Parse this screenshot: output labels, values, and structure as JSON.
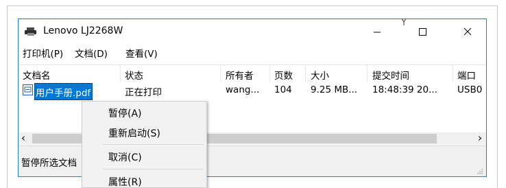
{
  "window": {
    "title": "Lenovo LJ2268W",
    "controls": {
      "minimize": "—",
      "maximize": "☐",
      "close": "✕"
    }
  },
  "menu": [
    {
      "label": "打印机(P)"
    },
    {
      "label": "文档(D)"
    },
    {
      "label": "查看(V)"
    }
  ],
  "columns": [
    "文档名",
    "状态",
    "所有者",
    "页数",
    "大小",
    "提交时间",
    "端口"
  ],
  "job": {
    "name": "用户手册.pdf",
    "status": "正在打印",
    "owner": "wang...",
    "pages": "104",
    "size": "9.25 MB...",
    "submitted": "18:48:39 20...",
    "port": "USB0"
  },
  "scroll": {
    "left_arrow": "‹",
    "right_arrow": "›"
  },
  "status_bar": {
    "text": "暂停所选文档"
  },
  "context_menu": {
    "items": [
      {
        "label": "暂停(A)"
      },
      {
        "label": "重新启动(S)"
      },
      {
        "label": "取消(C)"
      },
      {
        "label": "属性(R)"
      }
    ]
  },
  "colors": {
    "selection": "#0078d7",
    "window_border": "#1e80d8",
    "status_bg": "#f0f0f0"
  }
}
